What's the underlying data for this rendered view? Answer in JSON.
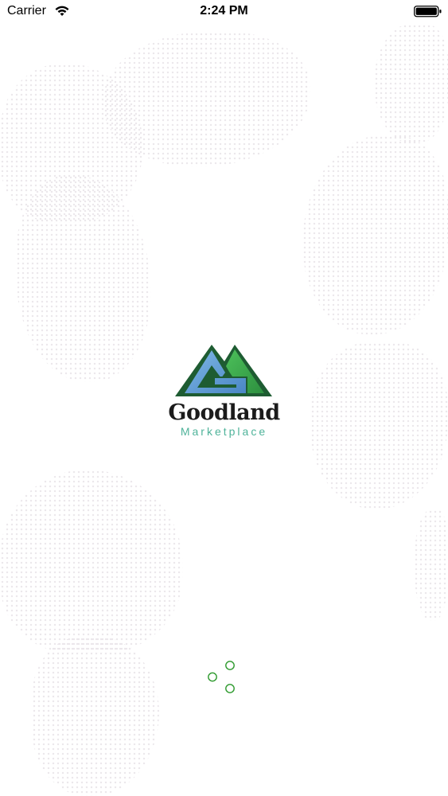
{
  "status_bar": {
    "carrier": "Carrier",
    "time": "2:24 PM",
    "wifi_icon": "wifi-icon",
    "battery_icon": "battery-icon"
  },
  "splash": {
    "brand_name": "Goodland",
    "brand_subtitle": "Marketplace",
    "logo_icon": "mountain-g-logo-icon",
    "colors": {
      "logo_dark_green": "#1e5c32",
      "logo_green": "#3aa04a",
      "logo_blue": "#5b9bd5",
      "subtitle_teal": "#4fb39a",
      "spinner_green": "#2e9a2e"
    }
  },
  "loading": {
    "icon": "loading-spinner-icon"
  }
}
